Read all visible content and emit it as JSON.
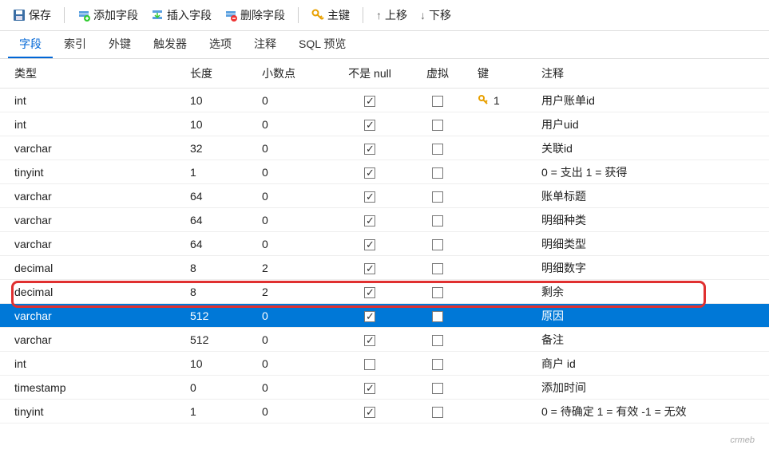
{
  "toolbar": {
    "save": "保存",
    "add_field": "添加字段",
    "insert_field": "插入字段",
    "delete_field": "删除字段",
    "primary_key": "主键",
    "move_up": "上移",
    "move_down": "下移"
  },
  "tabs": [
    {
      "label": "字段",
      "active": true
    },
    {
      "label": "索引",
      "active": false
    },
    {
      "label": "外键",
      "active": false
    },
    {
      "label": "触发器",
      "active": false
    },
    {
      "label": "选项",
      "active": false
    },
    {
      "label": "注释",
      "active": false
    },
    {
      "label": "SQL 预览",
      "active": false
    }
  ],
  "columns": {
    "type": "类型",
    "length": "长度",
    "decimals": "小数点",
    "not_null": "不是 null",
    "virtual": "虚拟",
    "key": "键",
    "comment": "注释"
  },
  "rows": [
    {
      "type": "int",
      "len": "10",
      "dec": "0",
      "nn": true,
      "virt": false,
      "key": "1",
      "comment": "用户账单id",
      "sel": false
    },
    {
      "type": "int",
      "len": "10",
      "dec": "0",
      "nn": true,
      "virt": false,
      "key": "",
      "comment": "用户uid",
      "sel": false
    },
    {
      "type": "varchar",
      "len": "32",
      "dec": "0",
      "nn": true,
      "virt": false,
      "key": "",
      "comment": "关联id",
      "sel": false
    },
    {
      "type": "tinyint",
      "len": "1",
      "dec": "0",
      "nn": true,
      "virt": false,
      "key": "",
      "comment": "0 = 支出 1 = 获得",
      "sel": false
    },
    {
      "type": "varchar",
      "len": "64",
      "dec": "0",
      "nn": true,
      "virt": false,
      "key": "",
      "comment": "账单标题",
      "sel": false
    },
    {
      "type": "varchar",
      "len": "64",
      "dec": "0",
      "nn": true,
      "virt": false,
      "key": "",
      "comment": "明细种类",
      "sel": false
    },
    {
      "type": "varchar",
      "len": "64",
      "dec": "0",
      "nn": true,
      "virt": false,
      "key": "",
      "comment": "明细类型",
      "sel": false
    },
    {
      "type": "decimal",
      "len": "8",
      "dec": "2",
      "nn": true,
      "virt": false,
      "key": "",
      "comment": "明细数字",
      "sel": false
    },
    {
      "type": "decimal",
      "len": "8",
      "dec": "2",
      "nn": true,
      "virt": false,
      "key": "",
      "comment": "剩余",
      "sel": false
    },
    {
      "type": "varchar",
      "len": "512",
      "dec": "0",
      "nn": true,
      "virt": false,
      "key": "",
      "comment": "原因",
      "sel": true
    },
    {
      "type": "varchar",
      "len": "512",
      "dec": "0",
      "nn": true,
      "virt": false,
      "key": "",
      "comment": "备注",
      "sel": false
    },
    {
      "type": "int",
      "len": "10",
      "dec": "0",
      "nn": false,
      "virt": false,
      "key": "",
      "comment": "商户 id",
      "sel": false
    },
    {
      "type": "timestamp",
      "len": "0",
      "dec": "0",
      "nn": true,
      "virt": false,
      "key": "",
      "comment": "添加时间",
      "sel": false
    },
    {
      "type": "tinyint",
      "len": "1",
      "dec": "0",
      "nn": true,
      "virt": false,
      "key": "",
      "comment": "0 = 待确定 1 = 有效 -1 = 无效",
      "sel": false
    }
  ],
  "watermark": "crmeb"
}
